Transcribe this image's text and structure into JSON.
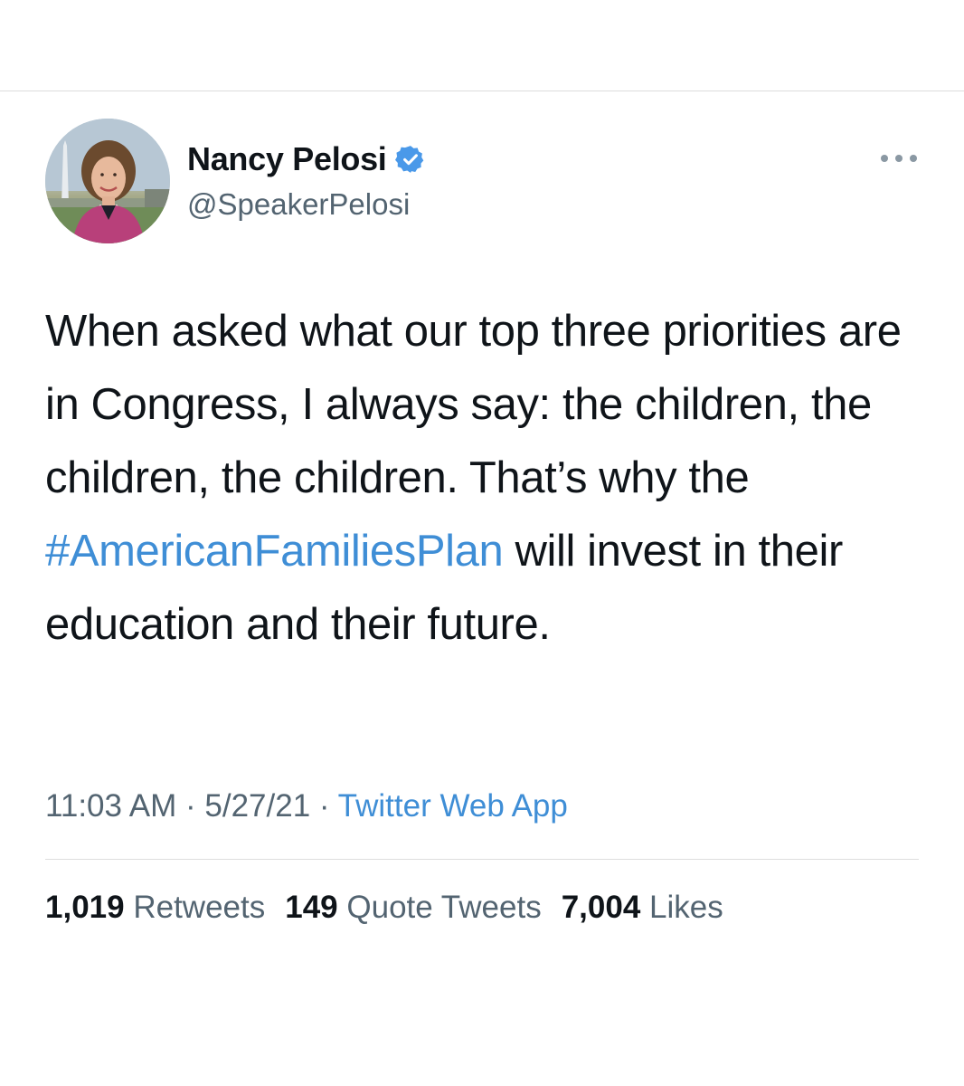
{
  "tweet": {
    "author": {
      "display_name": "Nancy Pelosi",
      "handle": "@SpeakerPelosi",
      "verified": true,
      "verified_color": "#4a99e9"
    },
    "text_segments": [
      "When asked what our top three priorities are in Congress, I always say: the children, the children, the children. That’s why the ",
      "#AmericanFamiliesPlan",
      " will invest in their education and their future."
    ],
    "time": "11:03 AM",
    "date": "5/27/21",
    "separator": "·",
    "source": "Twitter Web App",
    "stats": {
      "retweets_count": "1,019",
      "retweets_label": "Retweets",
      "quotes_count": "149",
      "quotes_label": "Quote Tweets",
      "likes_count": "7,004",
      "likes_label": "Likes"
    },
    "link_color": "#3f8ed6"
  }
}
